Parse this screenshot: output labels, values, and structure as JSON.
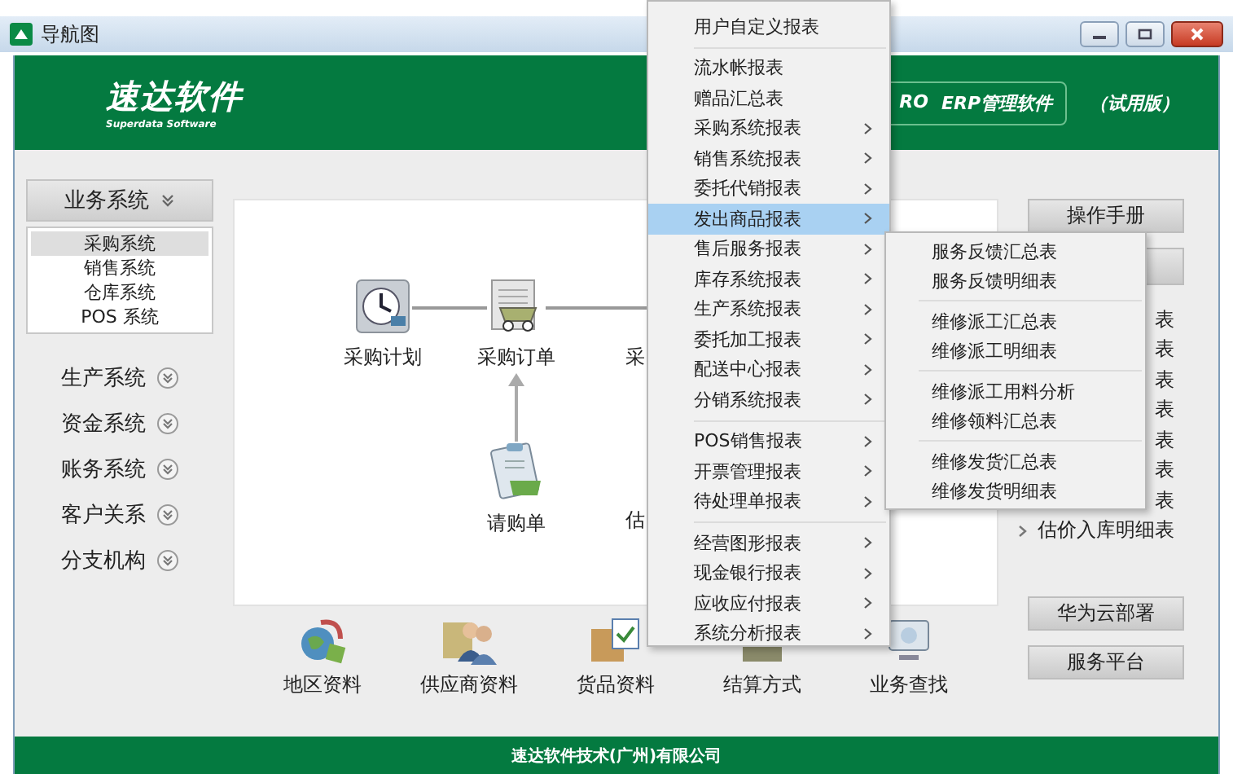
{
  "window": {
    "title": "导航图"
  },
  "header": {
    "logo": "速达软件",
    "logo_subtitle": "Superdata Software",
    "edition_prefix": "RO",
    "product": "ERP管理软件",
    "edition": "（试用版）"
  },
  "sidebar": {
    "groups": [
      {
        "label": "业务系统",
        "expanded": true,
        "items": [
          {
            "label": "采购系统",
            "selected": true
          },
          {
            "label": "销售系统",
            "selected": false
          },
          {
            "label": "仓库系统",
            "selected": false
          },
          {
            "label": "POS 系统",
            "selected": false
          }
        ]
      },
      {
        "label": "生产系统",
        "expanded": false
      },
      {
        "label": "资金系统",
        "expanded": false
      },
      {
        "label": "账务系统",
        "expanded": false
      },
      {
        "label": "客户关系",
        "expanded": false
      },
      {
        "label": "分支机构",
        "expanded": false
      }
    ]
  },
  "diagram": {
    "nodes": [
      {
        "label": "采购计划",
        "kind": "clock"
      },
      {
        "label": "采购订单",
        "kind": "cart"
      },
      {
        "label": "请购单",
        "kind": "clipboard"
      },
      {
        "label": "采",
        "kind": "hidden"
      },
      {
        "label": "估",
        "kind": "hidden"
      }
    ]
  },
  "shortcuts": [
    {
      "label": "地区资料",
      "kind": "globe"
    },
    {
      "label": "供应商资料",
      "kind": "people"
    },
    {
      "label": "货品资料",
      "kind": "box"
    },
    {
      "label": "结算方式",
      "kind": "cash"
    },
    {
      "label": "业务查找",
      "kind": "monitor"
    }
  ],
  "right_panel": {
    "manual_button": "操作手册",
    "report_links": [
      {
        "label": "表",
        "chevron": false
      },
      {
        "label": "表",
        "chevron": false
      },
      {
        "label": "表",
        "chevron": false
      },
      {
        "label": "表",
        "chevron": false
      },
      {
        "label": "表",
        "chevron": false
      },
      {
        "label": "表",
        "chevron": false
      },
      {
        "label": "表",
        "chevron": false
      },
      {
        "label": "估价入库明细表",
        "chevron": true
      }
    ],
    "buttons": [
      "华为云部署",
      "服务平台"
    ]
  },
  "footer": "速达软件技术(广州)有限公司",
  "menu": {
    "sections": [
      [
        {
          "label": "用户自定义报表",
          "submenu": false,
          "selected": false
        }
      ],
      [
        {
          "label": "流水帐报表",
          "submenu": false,
          "selected": false
        },
        {
          "label": "赠品汇总表",
          "submenu": false,
          "selected": false
        },
        {
          "label": "采购系统报表",
          "submenu": true,
          "selected": false
        },
        {
          "label": "销售系统报表",
          "submenu": true,
          "selected": false
        },
        {
          "label": "委托代销报表",
          "submenu": true,
          "selected": false
        },
        {
          "label": "发出商品报表",
          "submenu": true,
          "selected": true
        },
        {
          "label": "售后服务报表",
          "submenu": true,
          "selected": false
        },
        {
          "label": "库存系统报表",
          "submenu": true,
          "selected": false
        },
        {
          "label": "生产系统报表",
          "submenu": true,
          "selected": false
        },
        {
          "label": "委托加工报表",
          "submenu": true,
          "selected": false
        },
        {
          "label": "配送中心报表",
          "submenu": true,
          "selected": false
        },
        {
          "label": "分销系统报表",
          "submenu": true,
          "selected": false
        }
      ],
      [
        {
          "label": "POS销售报表",
          "submenu": true,
          "selected": false
        },
        {
          "label": "开票管理报表",
          "submenu": true,
          "selected": false
        },
        {
          "label": "待处理单报表",
          "submenu": true,
          "selected": false
        }
      ],
      [
        {
          "label": "经营图形报表",
          "submenu": true,
          "selected": false
        },
        {
          "label": "现金银行报表",
          "submenu": true,
          "selected": false
        },
        {
          "label": "应收应付报表",
          "submenu": true,
          "selected": false
        },
        {
          "label": "系统分析报表",
          "submenu": true,
          "selected": false
        }
      ]
    ]
  },
  "submenu": {
    "sections": [
      [
        "服务反馈汇总表",
        "服务反馈明细表"
      ],
      [
        "维修派工汇总表",
        "维修派工明细表"
      ],
      [
        "维修派工用料分析",
        "维修领料汇总表"
      ],
      [
        "维修发货汇总表",
        "维修发货明细表"
      ]
    ]
  }
}
